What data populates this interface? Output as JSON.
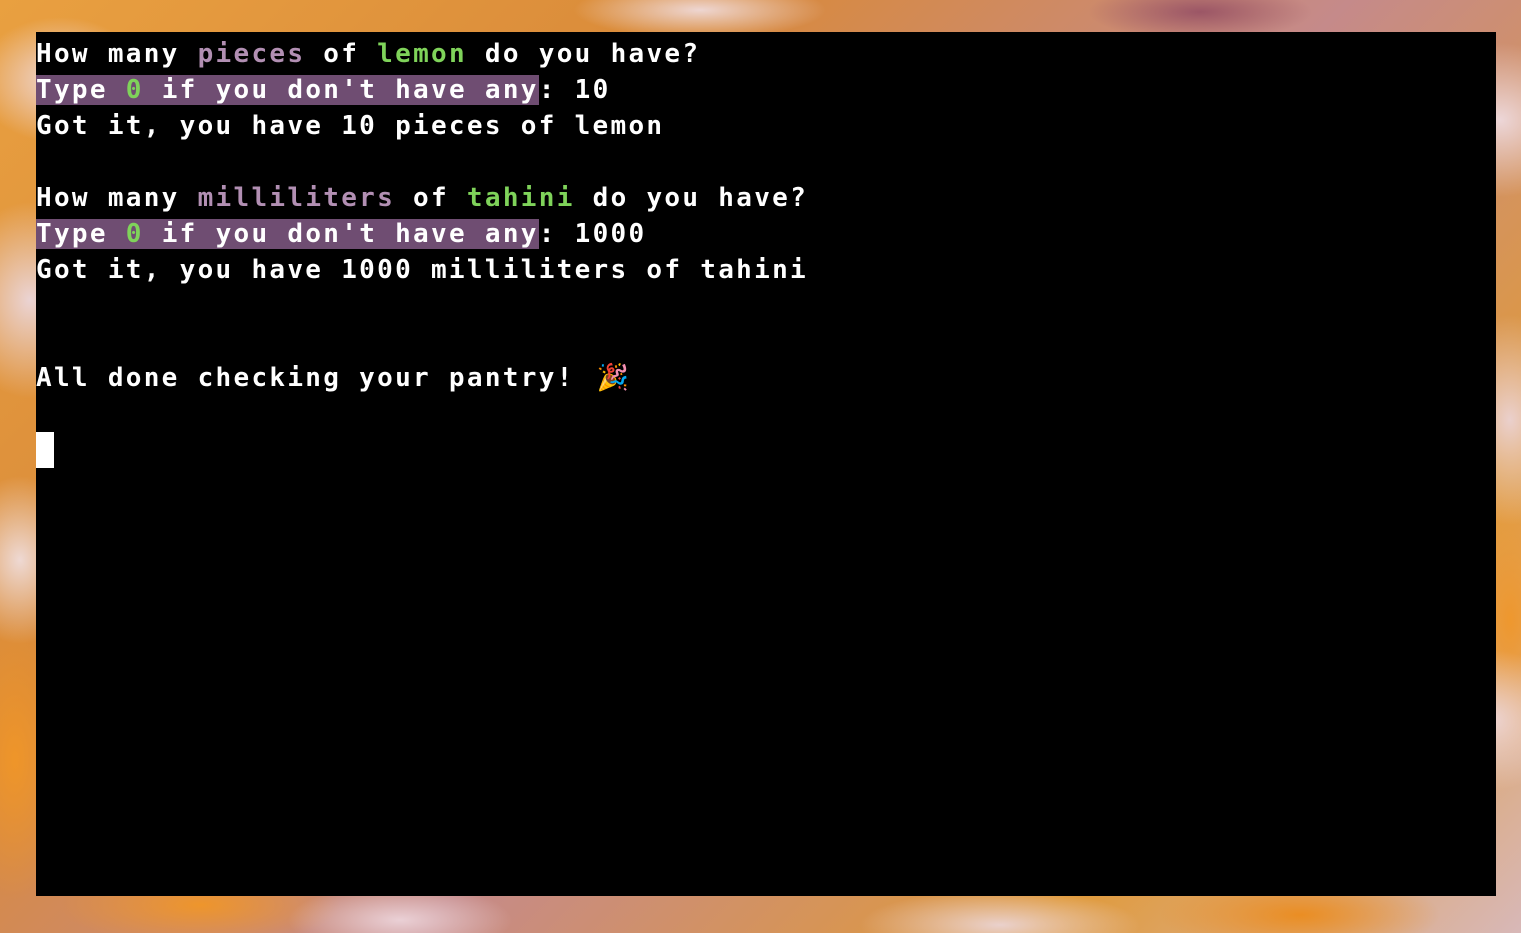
{
  "terminal": {
    "block1": {
      "q_prefix": "How many ",
      "unit": "pieces",
      "of": " of ",
      "food": "lemon",
      "q_suffix": " do you have?",
      "hint_a": "Type ",
      "hint_zero": "0",
      "hint_b": " if you don't have any",
      "input": ": 10",
      "confirm": "Got it, you have 10 pieces of lemon"
    },
    "block2": {
      "q_prefix": "How many ",
      "unit": "milliliters",
      "of": " of ",
      "food": "tahini",
      "q_suffix": " do you have?",
      "hint_a": "Type ",
      "hint_zero": "0",
      "hint_b": " if you don't have any",
      "input": ": 1000",
      "confirm": "Got it, you have 1000 milliliters of tahini"
    },
    "done_message": "All done checking your pantry! ",
    "done_emoji": "🎉"
  },
  "colors": {
    "unit_text": "#b28fb3",
    "food_text": "#7fd35a",
    "highlight_bg": "#6f4d72",
    "terminal_bg": "#000000"
  },
  "icons": {
    "done": "party-popper-icon"
  }
}
